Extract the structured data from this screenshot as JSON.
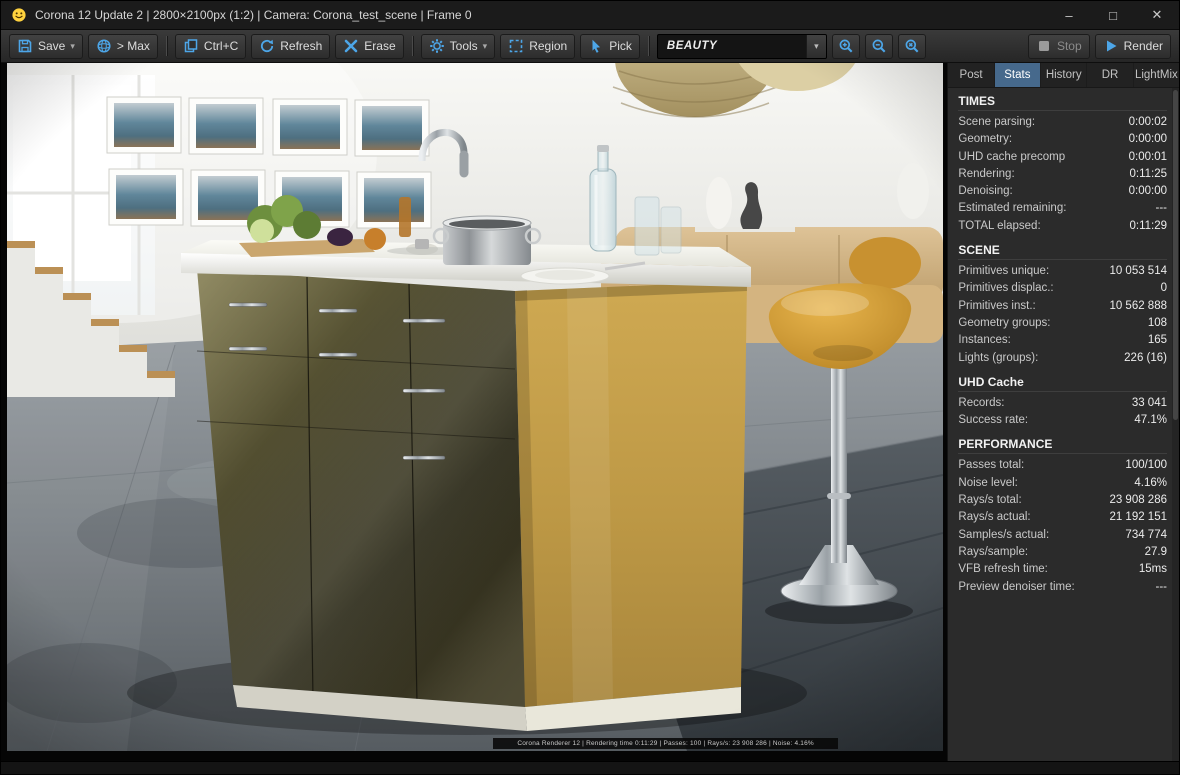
{
  "window": {
    "title": "Corona 12 Update 2 | 2800×2100px (1:2) | Camera: Corona_test_scene | Frame 0",
    "controls": {
      "minimize": "–",
      "maximize": "□",
      "close": "✕"
    }
  },
  "toolbar": {
    "save": "Save",
    "caret": "▾",
    "max": "> Max",
    "copy": "Ctrl+C",
    "refresh": "Refresh",
    "erase": "Erase",
    "tools": "Tools",
    "region": "Region",
    "pick": "Pick",
    "channel": "BEAUTY",
    "stop": "Stop",
    "render": "Render"
  },
  "panel": {
    "tabs": [
      {
        "label": "Post"
      },
      {
        "label": "Stats"
      },
      {
        "label": "History"
      },
      {
        "label": "DR"
      },
      {
        "label": "LightMix"
      }
    ],
    "sections": [
      {
        "title": "TIMES",
        "rows": [
          {
            "label": "Scene parsing:",
            "value": "0:00:02"
          },
          {
            "label": "Geometry:",
            "value": "0:00:00"
          },
          {
            "label": "UHD cache precomp",
            "value": "0:00:01"
          },
          {
            "label": "Rendering:",
            "value": "0:11:25"
          },
          {
            "label": "Denoising:",
            "value": "0:00:00"
          },
          {
            "label": "Estimated remaining:",
            "value": "---"
          },
          {
            "label": "TOTAL elapsed:",
            "value": "0:11:29"
          }
        ]
      },
      {
        "title": "SCENE",
        "rows": [
          {
            "label": "Primitives unique:",
            "value": "10 053 514"
          },
          {
            "label": "Primitives displac.:",
            "value": "0"
          },
          {
            "label": "Primitives inst.:",
            "value": "10 562 888"
          },
          {
            "label": "Geometry groups:",
            "value": "108"
          },
          {
            "label": "Instances:",
            "value": "165"
          },
          {
            "label": "Lights (groups):",
            "value": "226 (16)"
          }
        ]
      },
      {
        "title": "UHD Cache",
        "rows": [
          {
            "label": "Records:",
            "value": "33 041"
          },
          {
            "label": "Success rate:",
            "value": "47.1%"
          }
        ]
      },
      {
        "title": "PERFORMANCE",
        "rows": [
          {
            "label": "Passes total:",
            "value": "100/100"
          },
          {
            "label": "Noise level:",
            "value": "4.16%"
          },
          {
            "label": "Rays/s total:",
            "value": "23 908 286"
          },
          {
            "label": "Rays/s actual:",
            "value": "21 192 151"
          },
          {
            "label": "Samples/s actual:",
            "value": "734 774"
          },
          {
            "label": "Rays/sample:",
            "value": "27.9"
          },
          {
            "label": "VFB refresh time:",
            "value": "15ms"
          },
          {
            "label": "Preview denoiser time:",
            "value": "---"
          }
        ]
      }
    ]
  },
  "viewport": {
    "watermark": "Corona Renderer 12 | Rendering time 0:11:29 | Passes: 100 | Rays/s: 23 908 286 | Noise: 4.16%"
  },
  "colors": {
    "accent_blue": "#4da6e8",
    "active_tab": "#46698c",
    "cabinet_gold": "#bd9845",
    "stool_gold": "#c08c2b"
  }
}
